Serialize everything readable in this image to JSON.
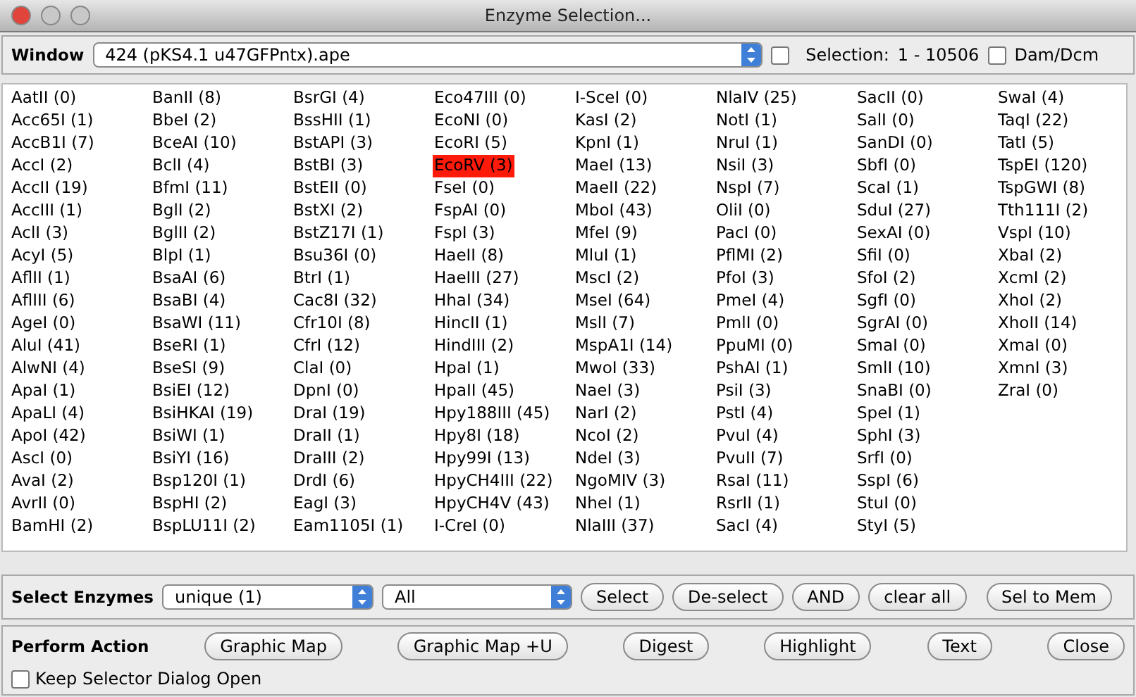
{
  "window": {
    "title": "Enzyme Selection..."
  },
  "source": {
    "label": "Window",
    "value": "424 (pKS4.1 u47GFPntx).ape",
    "range_checked": false,
    "selection_label": "Selection:",
    "selection_range": "1 - 10506",
    "dam_dcm": {
      "label": "Dam/Dcm",
      "checked": false
    }
  },
  "enzymes": [
    {
      "label": "AatII (0)",
      "selected": false
    },
    {
      "label": "Acc65I (1)",
      "selected": false
    },
    {
      "label": "AccB1I (7)",
      "selected": false
    },
    {
      "label": "AccI (2)",
      "selected": false
    },
    {
      "label": "AccII (19)",
      "selected": false
    },
    {
      "label": "AccIII (1)",
      "selected": false
    },
    {
      "label": "AclI (3)",
      "selected": false
    },
    {
      "label": "AcyI (5)",
      "selected": false
    },
    {
      "label": "AflII (1)",
      "selected": false
    },
    {
      "label": "AflIII (6)",
      "selected": false
    },
    {
      "label": "AgeI (0)",
      "selected": false
    },
    {
      "label": "AluI (41)",
      "selected": false
    },
    {
      "label": "AlwNI (4)",
      "selected": false
    },
    {
      "label": "ApaI (1)",
      "selected": false
    },
    {
      "label": "ApaLI (4)",
      "selected": false
    },
    {
      "label": "ApoI (42)",
      "selected": false
    },
    {
      "label": "AscI (0)",
      "selected": false
    },
    {
      "label": "AvaI (2)",
      "selected": false
    },
    {
      "label": "AvrII (0)",
      "selected": false
    },
    {
      "label": "BamHI (2)",
      "selected": false
    },
    {
      "label": "BanII (8)",
      "selected": false
    },
    {
      "label": "BbeI (2)",
      "selected": false
    },
    {
      "label": "BceAI (10)",
      "selected": false
    },
    {
      "label": "BclI (4)",
      "selected": false
    },
    {
      "label": "BfmI (11)",
      "selected": false
    },
    {
      "label": "BglI (2)",
      "selected": false
    },
    {
      "label": "BglII (2)",
      "selected": false
    },
    {
      "label": "BlpI (1)",
      "selected": false
    },
    {
      "label": "BsaAI (6)",
      "selected": false
    },
    {
      "label": "BsaBI (4)",
      "selected": false
    },
    {
      "label": "BsaWI (11)",
      "selected": false
    },
    {
      "label": "BseRI (1)",
      "selected": false
    },
    {
      "label": "BseSI (9)",
      "selected": false
    },
    {
      "label": "BsiEI (12)",
      "selected": false
    },
    {
      "label": "BsiHKAI (19)",
      "selected": false
    },
    {
      "label": "BsiWI (1)",
      "selected": false
    },
    {
      "label": "BsiYI (16)",
      "selected": false
    },
    {
      "label": "Bsp120I (1)",
      "selected": false
    },
    {
      "label": "BspHI (2)",
      "selected": false
    },
    {
      "label": "BspLU11I (2)",
      "selected": false
    },
    {
      "label": "BsrGI (4)",
      "selected": false
    },
    {
      "label": "BssHII (1)",
      "selected": false
    },
    {
      "label": "BstAPI (3)",
      "selected": false
    },
    {
      "label": "BstBI (3)",
      "selected": false
    },
    {
      "label": "BstEII (0)",
      "selected": false
    },
    {
      "label": "BstXI (2)",
      "selected": false
    },
    {
      "label": "BstZ17I (1)",
      "selected": false
    },
    {
      "label": "Bsu36I (0)",
      "selected": false
    },
    {
      "label": "BtrI (1)",
      "selected": false
    },
    {
      "label": "Cac8I (32)",
      "selected": false
    },
    {
      "label": "Cfr10I (8)",
      "selected": false
    },
    {
      "label": "CfrI (12)",
      "selected": false
    },
    {
      "label": "ClaI (0)",
      "selected": false
    },
    {
      "label": "DpnI (0)",
      "selected": false
    },
    {
      "label": "DraI (19)",
      "selected": false
    },
    {
      "label": "DraII (1)",
      "selected": false
    },
    {
      "label": "DraIII (2)",
      "selected": false
    },
    {
      "label": "DrdI (6)",
      "selected": false
    },
    {
      "label": "EagI (3)",
      "selected": false
    },
    {
      "label": "Eam1105I (1)",
      "selected": false
    },
    {
      "label": "Eco47III (0)",
      "selected": false
    },
    {
      "label": "EcoNI (0)",
      "selected": false
    },
    {
      "label": "EcoRI (5)",
      "selected": false
    },
    {
      "label": "EcoRV (3)",
      "selected": true
    },
    {
      "label": "FseI (0)",
      "selected": false
    },
    {
      "label": "FspAI (0)",
      "selected": false
    },
    {
      "label": "FspI (3)",
      "selected": false
    },
    {
      "label": "HaeII (8)",
      "selected": false
    },
    {
      "label": "HaeIII (27)",
      "selected": false
    },
    {
      "label": "HhaI (34)",
      "selected": false
    },
    {
      "label": "HincII (1)",
      "selected": false
    },
    {
      "label": "HindIII (2)",
      "selected": false
    },
    {
      "label": "HpaI (1)",
      "selected": false
    },
    {
      "label": "HpaII (45)",
      "selected": false
    },
    {
      "label": "Hpy188III (45)",
      "selected": false
    },
    {
      "label": "Hpy8I (18)",
      "selected": false
    },
    {
      "label": "Hpy99I (13)",
      "selected": false
    },
    {
      "label": "HpyCH4III (22)",
      "selected": false
    },
    {
      "label": "HpyCH4V (43)",
      "selected": false
    },
    {
      "label": "I-CreI (0)",
      "selected": false
    },
    {
      "label": "I-SceI (0)",
      "selected": false
    },
    {
      "label": "KasI (2)",
      "selected": false
    },
    {
      "label": "KpnI (1)",
      "selected": false
    },
    {
      "label": "MaeI (13)",
      "selected": false
    },
    {
      "label": "MaeII (22)",
      "selected": false
    },
    {
      "label": "MboI (43)",
      "selected": false
    },
    {
      "label": "MfeI (9)",
      "selected": false
    },
    {
      "label": "MluI (1)",
      "selected": false
    },
    {
      "label": "MscI (2)",
      "selected": false
    },
    {
      "label": "MseI (64)",
      "selected": false
    },
    {
      "label": "MslI (7)",
      "selected": false
    },
    {
      "label": "MspA1I (14)",
      "selected": false
    },
    {
      "label": "MwoI (33)",
      "selected": false
    },
    {
      "label": "NaeI (3)",
      "selected": false
    },
    {
      "label": "NarI (2)",
      "selected": false
    },
    {
      "label": "NcoI (2)",
      "selected": false
    },
    {
      "label": "NdeI (3)",
      "selected": false
    },
    {
      "label": "NgoMIV (3)",
      "selected": false
    },
    {
      "label": "NheI (1)",
      "selected": false
    },
    {
      "label": "NlaIII (37)",
      "selected": false
    },
    {
      "label": "NlaIV (25)",
      "selected": false
    },
    {
      "label": "NotI (1)",
      "selected": false
    },
    {
      "label": "NruI (1)",
      "selected": false
    },
    {
      "label": "NsiI (3)",
      "selected": false
    },
    {
      "label": "NspI (7)",
      "selected": false
    },
    {
      "label": "OliI (0)",
      "selected": false
    },
    {
      "label": "PacI (0)",
      "selected": false
    },
    {
      "label": "PflMI (2)",
      "selected": false
    },
    {
      "label": "PfoI (3)",
      "selected": false
    },
    {
      "label": "PmeI (4)",
      "selected": false
    },
    {
      "label": "PmlI (0)",
      "selected": false
    },
    {
      "label": "PpuMI (0)",
      "selected": false
    },
    {
      "label": "PshAI (1)",
      "selected": false
    },
    {
      "label": "PsiI (3)",
      "selected": false
    },
    {
      "label": "PstI (4)",
      "selected": false
    },
    {
      "label": "PvuI (4)",
      "selected": false
    },
    {
      "label": "PvuII (7)",
      "selected": false
    },
    {
      "label": "RsaI (11)",
      "selected": false
    },
    {
      "label": "RsrII (1)",
      "selected": false
    },
    {
      "label": "SacI (4)",
      "selected": false
    },
    {
      "label": "SacII (0)",
      "selected": false
    },
    {
      "label": "SalI (0)",
      "selected": false
    },
    {
      "label": "SanDI (0)",
      "selected": false
    },
    {
      "label": "SbfI (0)",
      "selected": false
    },
    {
      "label": "ScaI (1)",
      "selected": false
    },
    {
      "label": "SduI (27)",
      "selected": false
    },
    {
      "label": "SexAI (0)",
      "selected": false
    },
    {
      "label": "SfiI (0)",
      "selected": false
    },
    {
      "label": "SfoI (2)",
      "selected": false
    },
    {
      "label": "SgfI (0)",
      "selected": false
    },
    {
      "label": "SgrAI (0)",
      "selected": false
    },
    {
      "label": "SmaI (0)",
      "selected": false
    },
    {
      "label": "SmlI (10)",
      "selected": false
    },
    {
      "label": "SnaBI (0)",
      "selected": false
    },
    {
      "label": "SpeI (1)",
      "selected": false
    },
    {
      "label": "SphI (3)",
      "selected": false
    },
    {
      "label": "SrfI (0)",
      "selected": false
    },
    {
      "label": "SspI (6)",
      "selected": false
    },
    {
      "label": "StuI (0)",
      "selected": false
    },
    {
      "label": "StyI (5)",
      "selected": false
    },
    {
      "label": "SwaI (4)",
      "selected": false
    },
    {
      "label": "TaqI (22)",
      "selected": false
    },
    {
      "label": "TatI (5)",
      "selected": false
    },
    {
      "label": "TspEI (120)",
      "selected": false
    },
    {
      "label": "TspGWI (8)",
      "selected": false
    },
    {
      "label": "Tth111I (2)",
      "selected": false
    },
    {
      "label": "VspI (10)",
      "selected": false
    },
    {
      "label": "XbaI (2)",
      "selected": false
    },
    {
      "label": "XcmI (2)",
      "selected": false
    },
    {
      "label": "XhoI (2)",
      "selected": false
    },
    {
      "label": "XhoII (14)",
      "selected": false
    },
    {
      "label": "XmaI (0)",
      "selected": false
    },
    {
      "label": "XmnI (3)",
      "selected": false
    },
    {
      "label": "ZraI (0)",
      "selected": false
    }
  ],
  "select_bar": {
    "label": "Select Enzymes",
    "filter_1": "unique (1)",
    "filter_2": "All",
    "buttons": [
      "Select",
      "De-select",
      "AND",
      "clear all",
      "Sel to Mem"
    ]
  },
  "action_bar": {
    "label": "Perform Action",
    "buttons": [
      "Graphic Map",
      "Graphic Map +U",
      "Digest",
      "Highlight",
      "Text",
      "Close"
    ],
    "keep_open": {
      "label": "Keep Selector Dialog Open",
      "checked": false
    }
  }
}
